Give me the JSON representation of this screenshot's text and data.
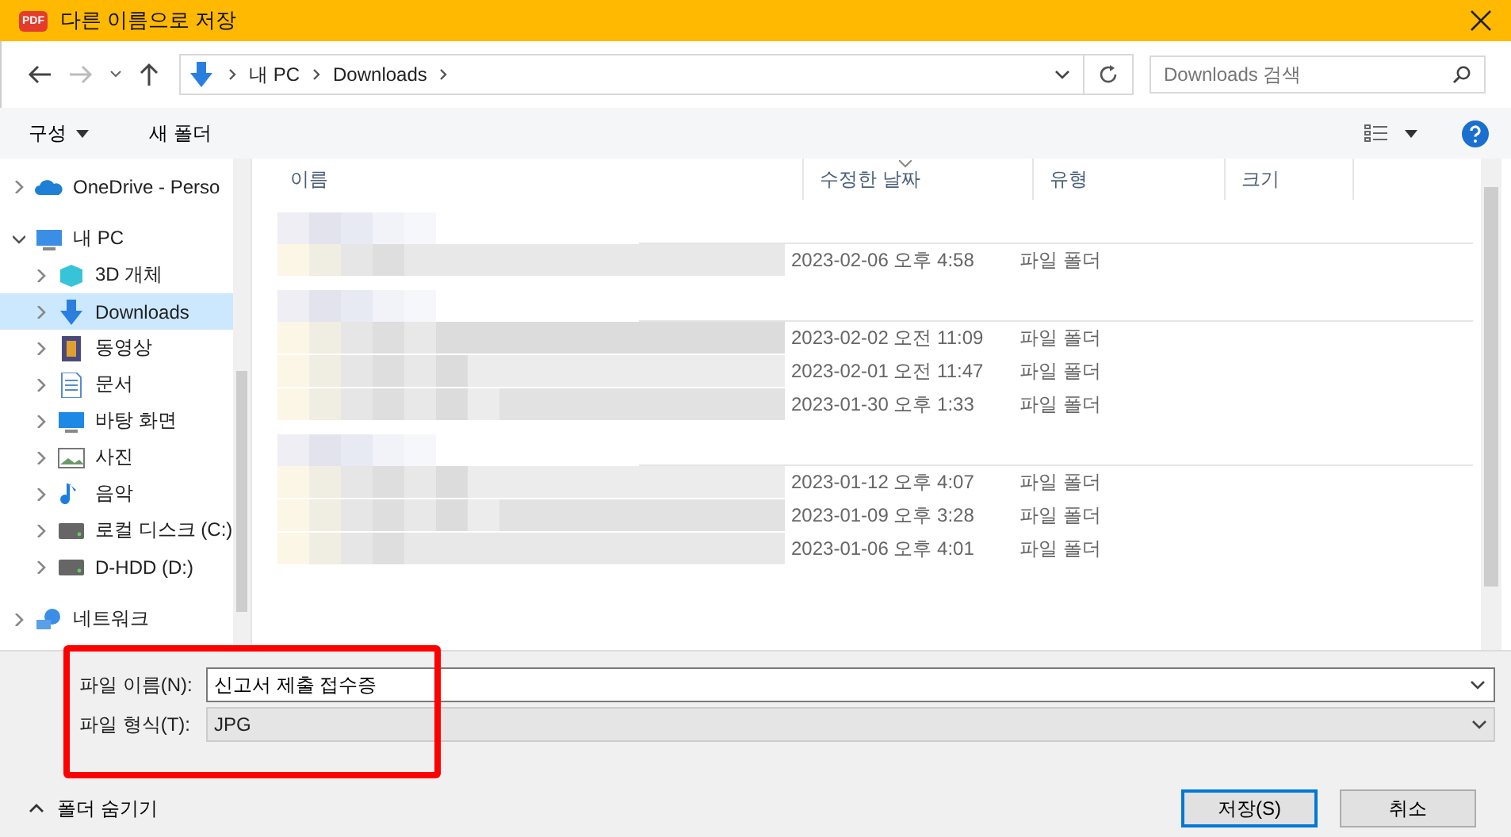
{
  "window": {
    "title": "다른 이름으로 저장",
    "app_badge": "PDF"
  },
  "address": {
    "path": [
      "내 PC",
      "Downloads"
    ]
  },
  "search": {
    "placeholder": "Downloads 검색"
  },
  "toolbar": [
    {
      "label": "구성",
      "dropdown": true
    },
    {
      "label": "새 폴더",
      "dropdown": false
    }
  ],
  "sidebar": {
    "items": [
      {
        "label": "OneDrive - Perso",
        "kind": "cloud",
        "expanded": false,
        "selected": false
      },
      {
        "label": "내 PC",
        "kind": "pc",
        "expanded": true,
        "selected": false,
        "children": [
          {
            "label": "3D 개체",
            "kind": "cube",
            "expanded": false,
            "selected": false
          },
          {
            "label": "Downloads",
            "kind": "download",
            "expanded": false,
            "selected": true
          },
          {
            "label": "동영상",
            "kind": "film",
            "expanded": false,
            "selected": false
          },
          {
            "label": "문서",
            "kind": "document",
            "expanded": false,
            "selected": false
          },
          {
            "label": "바탕 화면",
            "kind": "desktop",
            "expanded": false,
            "selected": false
          },
          {
            "label": "사진",
            "kind": "picture",
            "expanded": false,
            "selected": false
          },
          {
            "label": "음악",
            "kind": "music",
            "expanded": false,
            "selected": false
          },
          {
            "label": "로컬 디스크 (C:)",
            "kind": "disk",
            "expanded": false,
            "selected": false
          },
          {
            "label": "D-HDD (D:)",
            "kind": "disk",
            "expanded": false,
            "selected": false
          }
        ]
      },
      {
        "label": "네트워크",
        "kind": "network",
        "expanded": false,
        "selected": false
      }
    ]
  },
  "table": {
    "columns": [
      {
        "label": "이름",
        "sorted": false
      },
      {
        "label": "수정한 날짜",
        "sorted": true
      },
      {
        "label": "유형",
        "sorted": false
      },
      {
        "label": "크기",
        "sorted": false
      }
    ],
    "groups": [
      {
        "rows": [
          {
            "modified": "2023-02-06 오후 4:58",
            "type": "파일 폴더"
          }
        ]
      },
      {
        "rows": [
          {
            "modified": "2023-02-02 오전 11:09",
            "type": "파일 폴더"
          },
          {
            "modified": "2023-02-01 오전 11:47",
            "type": "파일 폴더"
          },
          {
            "modified": "2023-01-30 오후 1:33",
            "type": "파일 폴더"
          }
        ]
      },
      {
        "rows": [
          {
            "modified": "2023-01-12 오후 4:07",
            "type": "파일 폴더"
          },
          {
            "modified": "2023-01-09 오후 3:28",
            "type": "파일 폴더"
          },
          {
            "modified": "2023-01-06 오후 4:01",
            "type": "파일 폴더"
          }
        ]
      }
    ]
  },
  "file_fields": {
    "highlighted": true,
    "name": {
      "label": "파일 이름(N):",
      "value": "신고서 제출 접수증"
    },
    "type": {
      "label": "파일 형식(T):",
      "value": "JPG"
    }
  },
  "hide_folders": "폴더 숨기기",
  "buttons": [
    {
      "label": "저장(S)",
      "kind": "primary"
    },
    {
      "label": "취소",
      "kind": "normal"
    }
  ]
}
